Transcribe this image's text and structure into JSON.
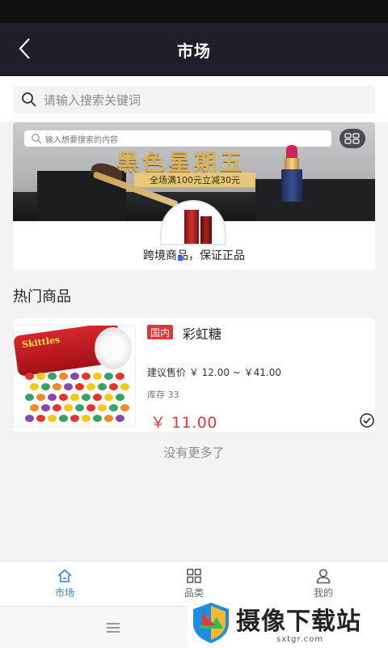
{
  "header": {
    "title": "市场"
  },
  "search": {
    "placeholder": "请输入搜索关键词"
  },
  "banner": {
    "search_placeholder": "输入想要搜索的内容",
    "headline": "黑色星期五",
    "promo": "全场满100元立减30元",
    "caption": "跨境商品，保证正品"
  },
  "section": {
    "title": "热门商品"
  },
  "products": [
    {
      "tag": "国内",
      "name": "彩虹糖",
      "price_range": "建议售价 ￥ 12.00 ~ ￥41.00",
      "stock": "库存 33",
      "price": "￥ 11.00",
      "image_label": "Skittles"
    }
  ],
  "list_end": "没有更多了",
  "tabbar": {
    "items": [
      {
        "label": "市场",
        "icon": "home-icon",
        "active": true
      },
      {
        "label": "品类",
        "icon": "grid-icon",
        "active": false
      },
      {
        "label": "我的",
        "icon": "user-icon",
        "active": false
      }
    ]
  },
  "watermark": {
    "text": "摄像下载站",
    "url": "sxtgr.com"
  },
  "colors": {
    "nav_bg": "#1e2029",
    "accent_blue": "#2c82d9",
    "price_red": "#e03b3b",
    "tag_red": "#e2363a"
  }
}
